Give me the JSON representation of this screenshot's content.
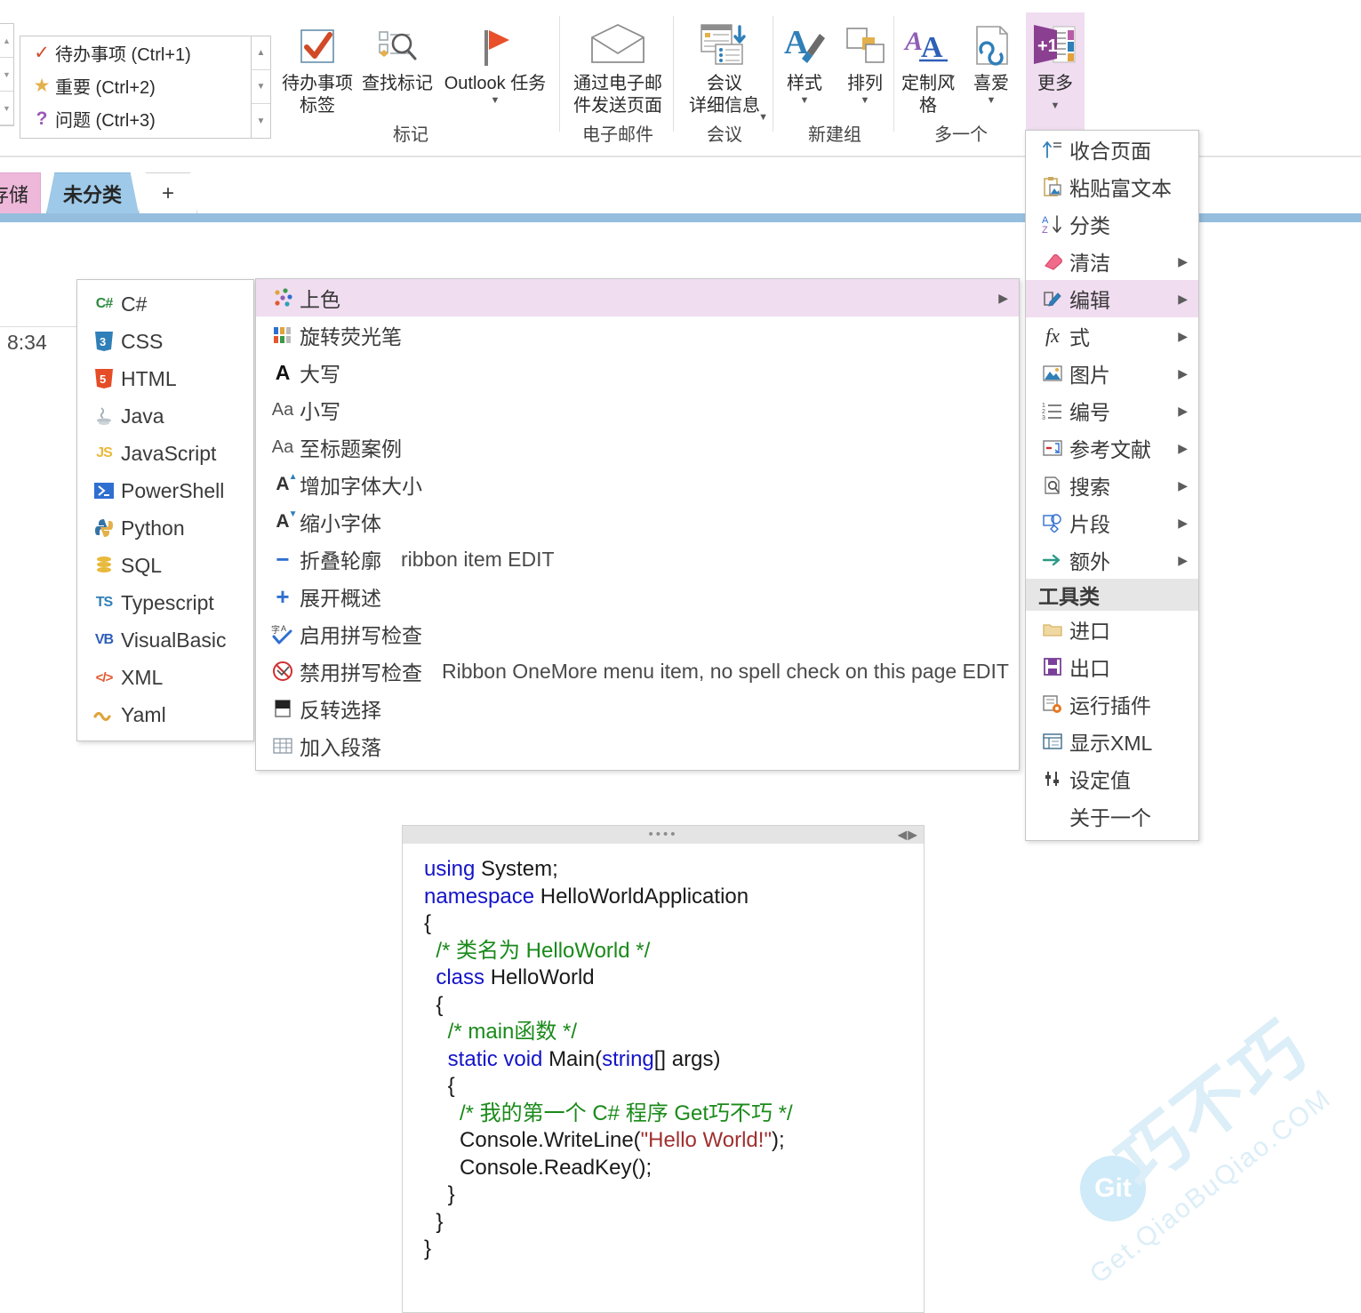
{
  "ribbon": {
    "tag_gallery": [
      {
        "glyph": "✓",
        "color": "#d04a28",
        "label": "待办事项 (Ctrl+1)"
      },
      {
        "glyph": "★",
        "color": "#e3b04b",
        "label": "重要 (Ctrl+2)"
      },
      {
        "glyph": "?",
        "color": "#9b59b6",
        "label": "问题 (Ctrl+3)"
      }
    ],
    "groups": [
      {
        "name": "mark",
        "label": "标记"
      },
      {
        "name": "email",
        "label": "电子邮件"
      },
      {
        "name": "meeting",
        "label": "会议"
      },
      {
        "name": "newgroup",
        "label": "新建组"
      },
      {
        "name": "onemore",
        "label": "多一个"
      }
    ],
    "buttons": {
      "todo_tag": "待办事项\n标签",
      "find_tags": "查找标记",
      "outlook_task": "Outlook 任务",
      "send_page_email": "通过电子邮\n件发送页面",
      "meeting_details": "会议\n详细信息",
      "styles": "样式",
      "arrange": "排列",
      "custom_styles": "定制风\n格",
      "favorites": "喜爱",
      "more": "更多",
      "more_badge": "+1"
    }
  },
  "tabs": {
    "storage": "存储",
    "uncategorized": "未分类",
    "add": "+"
  },
  "page": {
    "time": "8:34"
  },
  "lang_menu": {
    "items": [
      {
        "label": "C#",
        "icon": "csharp-icon",
        "badge": "C#",
        "color": "#2d8a3e"
      },
      {
        "label": "CSS",
        "icon": "css-icon",
        "badge": "3",
        "color": "#2f7fb8"
      },
      {
        "label": "HTML",
        "icon": "html-icon",
        "badge": "5",
        "color": "#e44d26"
      },
      {
        "label": "Java",
        "icon": "java-icon",
        "badge": "☕",
        "color": "#9aa6ad"
      },
      {
        "label": "JavaScript",
        "icon": "javascript-icon",
        "badge": "JS",
        "color": "#e8b93a"
      },
      {
        "label": "PowerShell",
        "icon": "powershell-icon",
        "badge": "≥_",
        "color": "#2f6fd0"
      },
      {
        "label": "Python",
        "icon": "python-icon",
        "badge": "🐍",
        "color": "#3572a5"
      },
      {
        "label": "SQL",
        "icon": "sql-icon",
        "badge": "⛁",
        "color": "#e8b93a"
      },
      {
        "label": "Typescript",
        "icon": "typescript-icon",
        "badge": "TS",
        "color": "#2f7fb8"
      },
      {
        "label": "VisualBasic",
        "icon": "visualbasic-icon",
        "badge": "VB",
        "color": "#2f5fb8"
      },
      {
        "label": "XML",
        "icon": "xml-icon",
        "badge": "</>",
        "color": "#e4572e"
      },
      {
        "label": "Yaml",
        "icon": "yaml-icon",
        "badge": "〰",
        "color": "#e0a43a"
      }
    ]
  },
  "edit_menu": {
    "items": [
      {
        "label": "上色",
        "icon": "color-dots-icon",
        "note": "",
        "highlight": true,
        "arrow": true
      },
      {
        "label": "旋转荧光笔",
        "icon": "highlighter-grid-icon",
        "note": "",
        "highlight": false,
        "arrow": false
      },
      {
        "label": "大写",
        "icon": "uppercase-icon",
        "note": "",
        "highlight": false,
        "arrow": false
      },
      {
        "label": "小写",
        "icon": "lowercase-icon",
        "note": "",
        "highlight": false,
        "arrow": false
      },
      {
        "label": "至标题案例",
        "icon": "titlecase-icon",
        "note": "",
        "highlight": false,
        "arrow": false
      },
      {
        "label": "增加字体大小",
        "icon": "increase-font-icon",
        "note": "",
        "highlight": false,
        "arrow": false
      },
      {
        "label": "缩小字体",
        "icon": "decrease-font-icon",
        "note": "",
        "highlight": false,
        "arrow": false
      },
      {
        "label": "折叠轮廓",
        "icon": "collapse-outline-icon",
        "note": "ribbon item EDIT",
        "highlight": false,
        "arrow": false
      },
      {
        "label": "展开概述",
        "icon": "expand-outline-icon",
        "note": "",
        "highlight": false,
        "arrow": false
      },
      {
        "label": "启用拼写检查",
        "icon": "enable-spellcheck-icon",
        "note": "",
        "highlight": false,
        "arrow": false
      },
      {
        "label": "禁用拼写检查",
        "icon": "disable-spellcheck-icon",
        "note": "Ribbon OneMore menu item, no spell check on this page EDIT",
        "highlight": false,
        "arrow": false
      },
      {
        "label": "反转选择",
        "icon": "invert-selection-icon",
        "note": "",
        "highlight": false,
        "arrow": false
      },
      {
        "label": "加入段落",
        "icon": "join-paragraph-icon",
        "note": "",
        "highlight": false,
        "arrow": false
      }
    ]
  },
  "more_menu": {
    "items": [
      {
        "label": "收合页面",
        "icon": "collapse-page-icon",
        "arrow": false,
        "highlight": false
      },
      {
        "label": "粘贴富文本",
        "icon": "paste-rich-text-icon",
        "arrow": false,
        "highlight": false
      },
      {
        "label": "分类",
        "icon": "sort-az-icon",
        "arrow": false,
        "highlight": false
      },
      {
        "label": "清洁",
        "icon": "eraser-icon",
        "arrow": true,
        "highlight": false
      },
      {
        "label": "编辑",
        "icon": "edit-icon",
        "arrow": true,
        "highlight": true
      },
      {
        "label": "式",
        "icon": "formula-icon",
        "arrow": true,
        "highlight": false
      },
      {
        "label": "图片",
        "icon": "image-icon",
        "arrow": true,
        "highlight": false
      },
      {
        "label": "编号",
        "icon": "numbering-icon",
        "arrow": true,
        "highlight": false
      },
      {
        "label": "参考文献",
        "icon": "reference-icon",
        "arrow": true,
        "highlight": false
      },
      {
        "label": "搜索",
        "icon": "search-icon",
        "arrow": true,
        "highlight": false
      },
      {
        "label": "片段",
        "icon": "snippet-icon",
        "arrow": true,
        "highlight": false
      },
      {
        "label": "额外",
        "icon": "extras-arrow-icon",
        "arrow": true,
        "highlight": false
      }
    ],
    "section_header": "工具类",
    "tools": [
      {
        "label": "进口",
        "icon": "import-folder-icon",
        "arrow": false
      },
      {
        "label": "出口",
        "icon": "export-save-icon",
        "arrow": false
      },
      {
        "label": "运行插件",
        "icon": "run-plugin-icon",
        "arrow": false
      },
      {
        "label": "显示XML",
        "icon": "show-xml-icon",
        "arrow": false
      },
      {
        "label": "设定值",
        "icon": "settings-icon",
        "arrow": false
      },
      {
        "label": "关于一个",
        "icon": "",
        "arrow": false
      }
    ]
  },
  "code_block": {
    "lines": [
      [
        {
          "t": "using ",
          "c": "kw"
        },
        {
          "t": "System;",
          "c": ""
        }
      ],
      [
        {
          "t": "namespace ",
          "c": "kw"
        },
        {
          "t": "HelloWorldApplication",
          "c": ""
        }
      ],
      [
        {
          "t": "{",
          "c": ""
        }
      ],
      [
        {
          "t": "  /* 类名为 HelloWorld */",
          "c": "cm"
        }
      ],
      [
        {
          "t": "  class ",
          "c": "kw"
        },
        {
          "t": "HelloWorld",
          "c": ""
        }
      ],
      [
        {
          "t": "  {",
          "c": ""
        }
      ],
      [
        {
          "t": "    /* main函数 */",
          "c": "cm"
        }
      ],
      [
        {
          "t": "    static void ",
          "c": "kw"
        },
        {
          "t": "Main(",
          "c": ""
        },
        {
          "t": "string",
          "c": "kw"
        },
        {
          "t": "[] args)",
          "c": ""
        }
      ],
      [
        {
          "t": "    {",
          "c": ""
        }
      ],
      [
        {
          "t": "      /* 我的第一个 C# 程序 Get巧不巧 */",
          "c": "cm"
        }
      ],
      [
        {
          "t": "      Console.WriteLine(",
          "c": ""
        },
        {
          "t": "\"Hello World!\"",
          "c": "st"
        },
        {
          "t": ");",
          "c": ""
        }
      ],
      [
        {
          "t": "      Console.ReadKey();",
          "c": ""
        }
      ],
      [
        {
          "t": "    }",
          "c": ""
        }
      ],
      [
        {
          "t": "  }",
          "c": ""
        }
      ],
      [
        {
          "t": "}",
          "c": ""
        }
      ]
    ],
    "dots": "••••",
    "arrows": "◀▶"
  },
  "watermark": {
    "cn": "巧不巧",
    "en": "Get.QiaoBuQiao.COM",
    "logo": "Git"
  },
  "colors": {
    "accent_purple": "#f0ddf0",
    "tab_active": "#9ec9e8",
    "tab_storage": "#eeb8da",
    "underline": "#95bede"
  }
}
